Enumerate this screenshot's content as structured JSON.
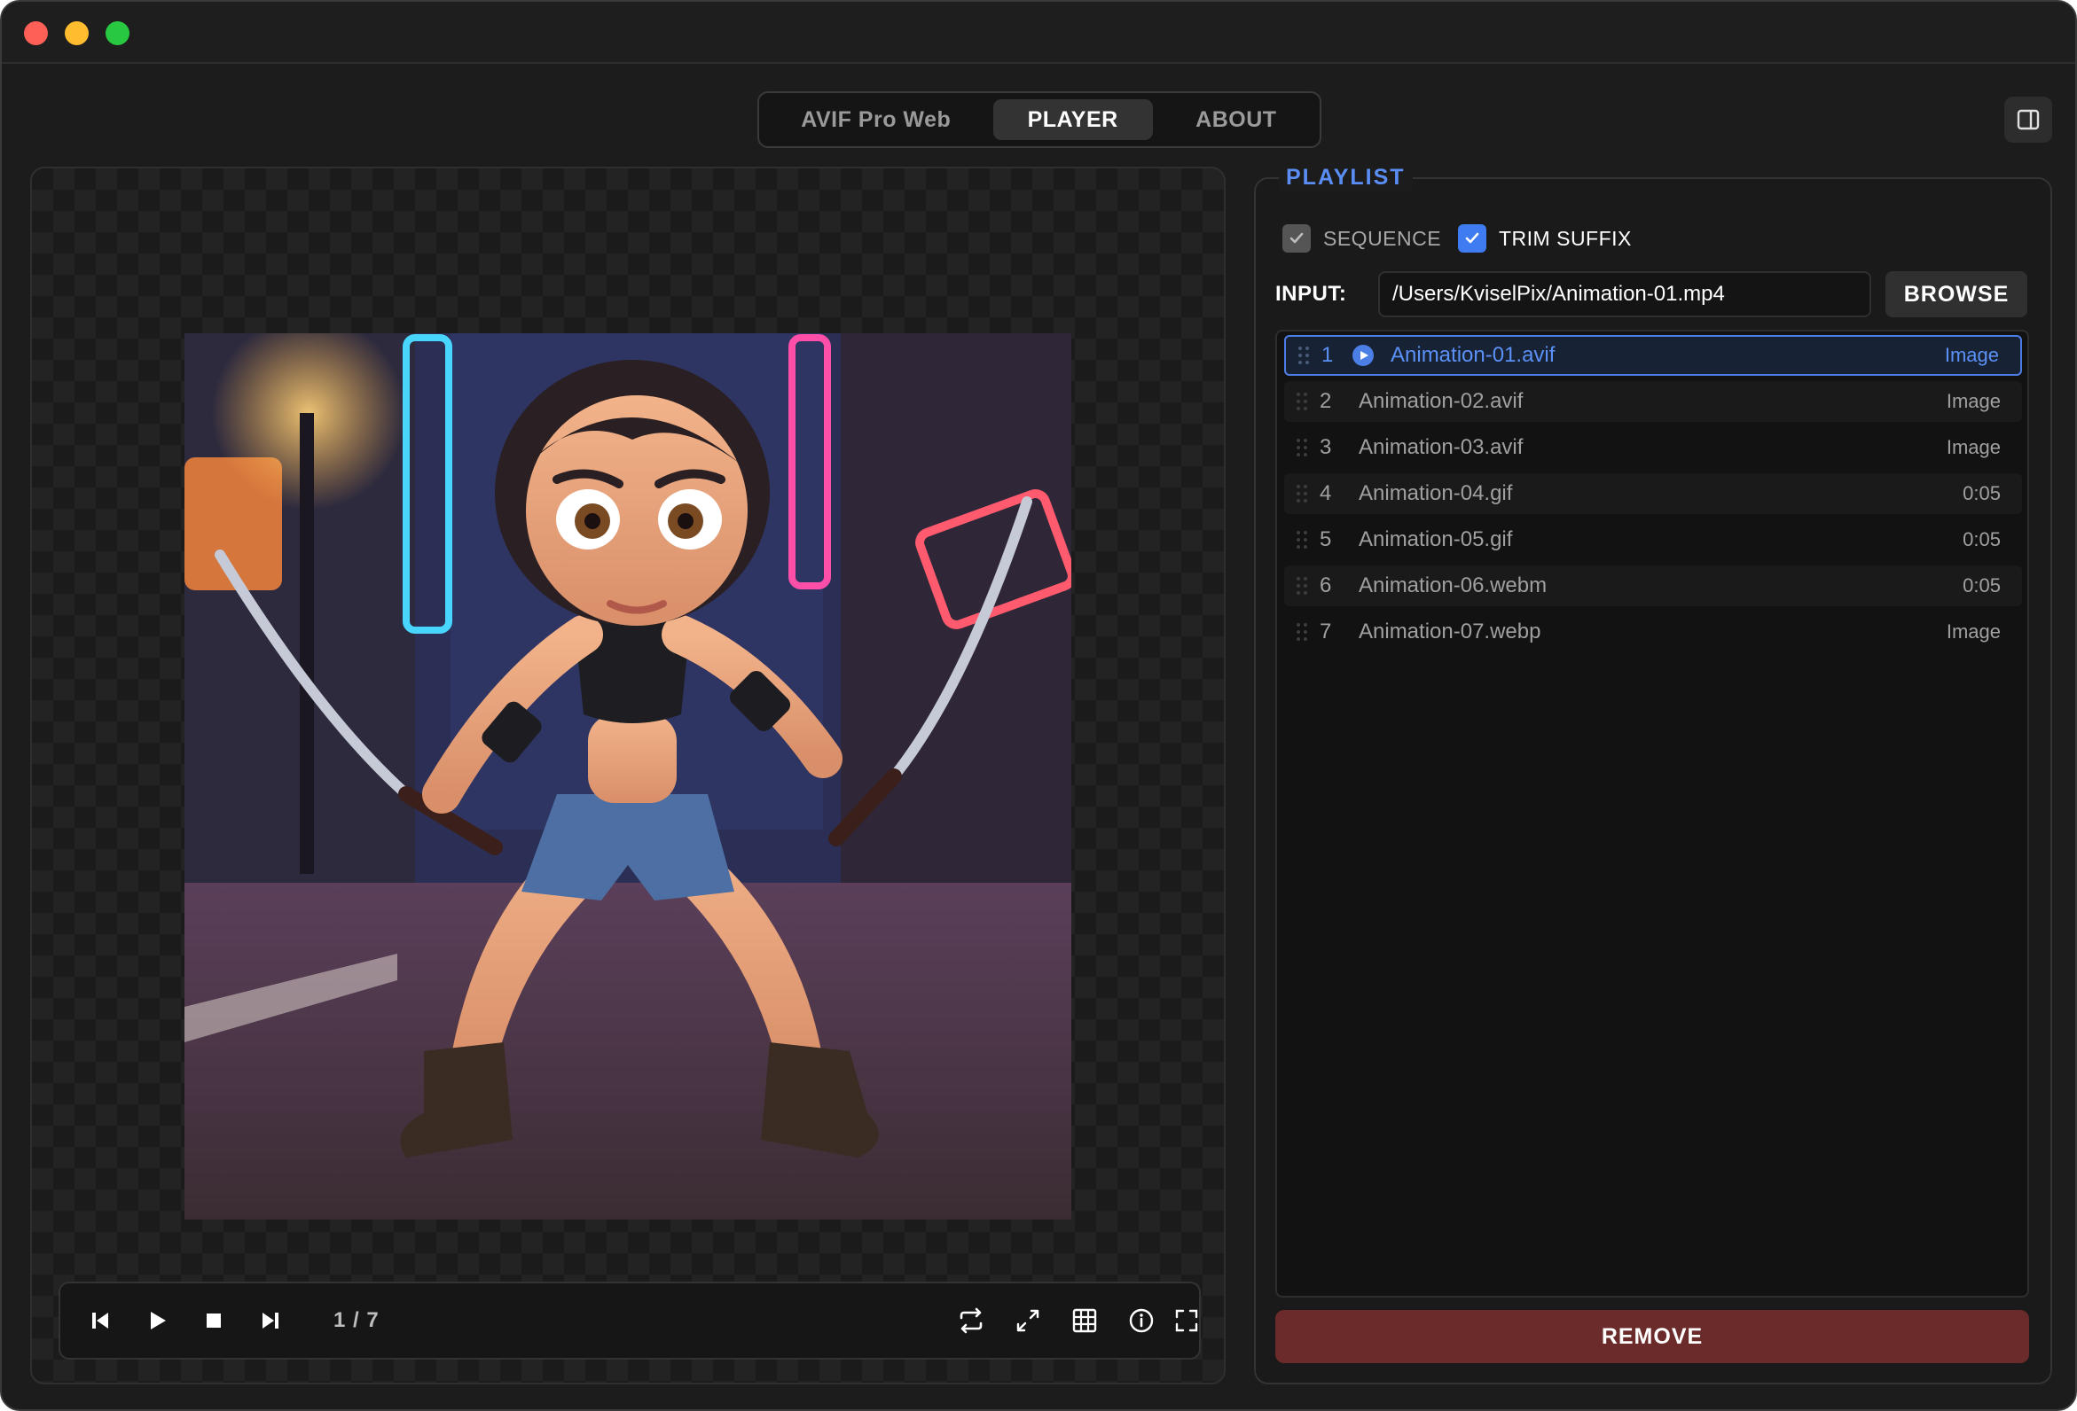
{
  "tabs": [
    {
      "label": "AVIF Pro Web"
    },
    {
      "label": "PLAYER"
    },
    {
      "label": "ABOUT"
    }
  ],
  "player": {
    "counter": "1 / 7"
  },
  "playlist": {
    "title": "PLAYLIST",
    "sequence_label": "SEQUENCE",
    "trim_suffix_label": "TRIM SUFFIX",
    "input_label": "INPUT:",
    "input_value": "/Users/KviselPix/Animation-01.mp4",
    "browse_label": "BROWSE",
    "remove_label": "REMOVE",
    "items": [
      {
        "index": "1",
        "name": "Animation-01.avif",
        "kind": "Image"
      },
      {
        "index": "2",
        "name": "Animation-02.avif",
        "kind": "Image"
      },
      {
        "index": "3",
        "name": "Animation-03.avif",
        "kind": "Image"
      },
      {
        "index": "4",
        "name": "Animation-04.gif",
        "kind": "0:05"
      },
      {
        "index": "5",
        "name": "Animation-05.gif",
        "kind": "0:05"
      },
      {
        "index": "6",
        "name": "Animation-06.webm",
        "kind": "0:05"
      },
      {
        "index": "7",
        "name": "Animation-07.webp",
        "kind": "Image"
      }
    ]
  },
  "colors": {
    "accent": "#4b7fe6",
    "remove": "#6b2b2b",
    "window_bg": "#1c1c1c"
  }
}
